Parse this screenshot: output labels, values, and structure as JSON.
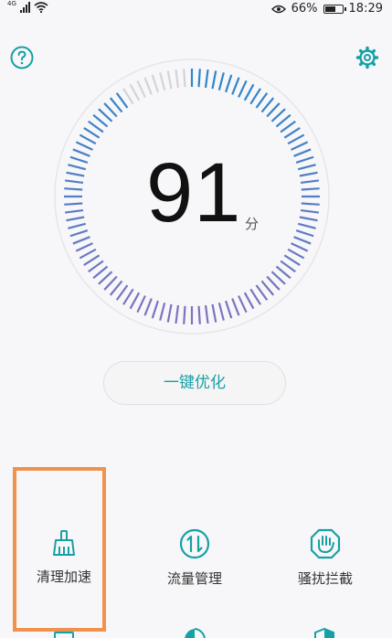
{
  "status_bar": {
    "network_type": "4G",
    "battery_percent": "66%",
    "battery_level": 0.66,
    "time": "18:29",
    "icons": [
      "signal-icon",
      "wifi-icon",
      "eye-icon",
      "battery-icon"
    ]
  },
  "header": {
    "help_icon": "question-circle-icon",
    "settings_icon": "gear-icon"
  },
  "gauge": {
    "score": "91",
    "unit": "分",
    "score_fraction": 0.91,
    "colors": {
      "active_start": "#2f86c9",
      "active_end": "#7d74bf",
      "inactive": "#d4d4d8"
    }
  },
  "optimize_button": {
    "label": "一键优化"
  },
  "tools": [
    {
      "label": "清理加速",
      "icon": "broom-icon"
    },
    {
      "label": "流量管理",
      "icon": "data-traffic-icon"
    },
    {
      "label": "骚扰拦截",
      "icon": "block-hand-icon"
    }
  ],
  "colors": {
    "accent": "#17a0a5",
    "highlight_box": "#f0924c",
    "background": "#f7f7f9"
  }
}
